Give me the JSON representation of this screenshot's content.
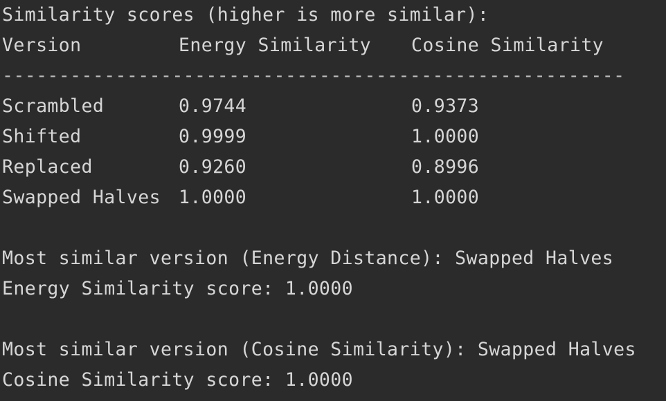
{
  "output": {
    "header_line": "Similarity scores (higher is more similar):",
    "table": {
      "columns": [
        "Version",
        "Energy Similarity",
        "Cosine Similarity"
      ],
      "separator": "-------------------------------------------------------",
      "rows": [
        {
          "version": "Scrambled",
          "energy": "0.9744",
          "cosine": "0.9373"
        },
        {
          "version": "Shifted",
          "energy": "0.9999",
          "cosine": "1.0000"
        },
        {
          "version": "Replaced",
          "energy": "0.9260",
          "cosine": "0.8996"
        },
        {
          "version": "Swapped Halves",
          "energy": "1.0000",
          "cosine": "1.0000"
        }
      ]
    },
    "energy_result": {
      "most_similar": "Most similar version (Energy Distance): Swapped Halves",
      "score": "Energy Similarity score: 1.0000"
    },
    "cosine_result": {
      "most_similar": "Most similar version (Cosine Similarity): Swapped Halves",
      "score": "Cosine Similarity score: 1.0000"
    }
  },
  "colors": {
    "background": "#2b2b2b",
    "text": "#d6d6d6"
  }
}
